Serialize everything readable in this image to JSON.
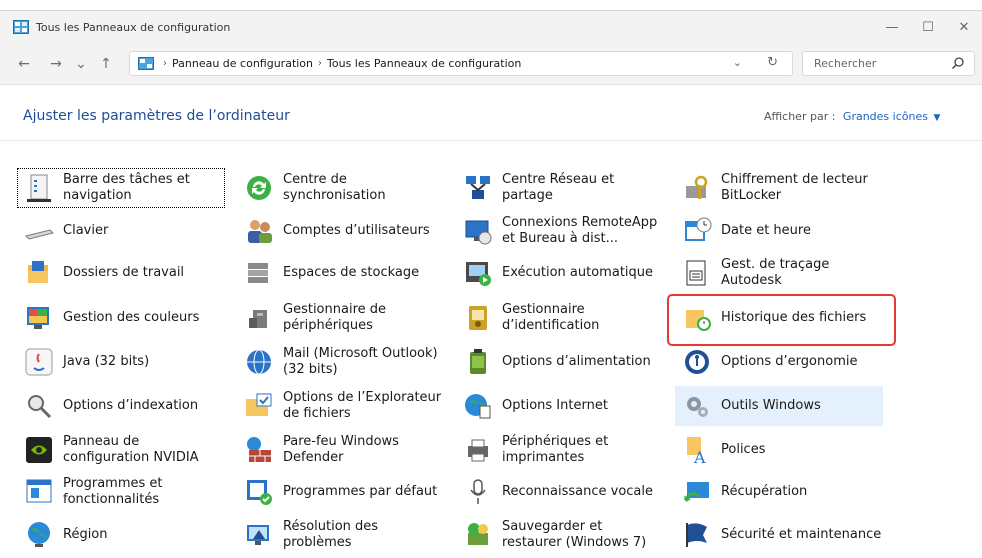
{
  "window": {
    "title": "Tous les Panneaux de configuration",
    "controls": {
      "minimize": "—",
      "maximize": "☐",
      "close": "✕"
    }
  },
  "nav": {
    "back": "←",
    "forward": "→",
    "recent": "⌄",
    "up": "↑"
  },
  "address": {
    "crumbs": [
      "Panneau de configuration",
      "Tous les Panneaux de configuration"
    ],
    "separator": "›",
    "dropdown": "⌄",
    "refresh": "↻"
  },
  "search": {
    "placeholder": "Rechercher"
  },
  "page": {
    "title": "Ajuster les paramètres de l’ordinateur",
    "view_by_label": "Afficher par :",
    "view_by_value": "Grandes icônes",
    "view_by_caret": "▼"
  },
  "items": [
    {
      "label": "Barre des tâches et navigation",
      "icon": "taskbar-icon"
    },
    {
      "label": "Centre de synchronisation",
      "icon": "sync-icon"
    },
    {
      "label": "Centre Réseau et partage",
      "icon": "network-icon"
    },
    {
      "label": "Chiffrement de lecteur BitLocker",
      "icon": "bitlocker-icon"
    },
    {
      "label": "Clavier",
      "icon": "keyboard-icon"
    },
    {
      "label": "Comptes d’utilisateurs",
      "icon": "users-icon"
    },
    {
      "label": "Connexions RemoteApp et Bureau à dist...",
      "icon": "remoteapp-icon"
    },
    {
      "label": "Date et heure",
      "icon": "clock-icon"
    },
    {
      "label": "Dossiers de travail",
      "icon": "work-folders-icon"
    },
    {
      "label": "Espaces de stockage",
      "icon": "storage-icon"
    },
    {
      "label": "Exécution automatique",
      "icon": "autoplay-icon"
    },
    {
      "label": "Gest. de traçage Autodesk",
      "icon": "autodesk-icon"
    },
    {
      "label": "Gestion des couleurs",
      "icon": "color-icon"
    },
    {
      "label": "Gestionnaire de périphériques",
      "icon": "device-manager-icon"
    },
    {
      "label": "Gestionnaire d’identification",
      "icon": "credential-icon"
    },
    {
      "label": "Historique des fichiers",
      "icon": "file-history-icon"
    },
    {
      "label": "Java (32 bits)",
      "icon": "java-icon"
    },
    {
      "label": "Mail (Microsoft Outlook) (32 bits)",
      "icon": "mail-icon"
    },
    {
      "label": "Options d’alimentation",
      "icon": "power-icon"
    },
    {
      "label": "Options d’ergonomie",
      "icon": "accessibility-icon"
    },
    {
      "label": "Options d’indexation",
      "icon": "indexing-icon"
    },
    {
      "label": "Options de l’Explorateur de fichiers",
      "icon": "explorer-options-icon"
    },
    {
      "label": "Options Internet",
      "icon": "internet-icon"
    },
    {
      "label": "Outils Windows",
      "icon": "gear-tools-icon"
    },
    {
      "label": "Panneau de configuration NVIDIA",
      "icon": "nvidia-icon"
    },
    {
      "label": "Pare-feu Windows Defender",
      "icon": "firewall-icon"
    },
    {
      "label": "Périphériques et imprimantes",
      "icon": "printer-icon"
    },
    {
      "label": "Polices",
      "icon": "fonts-icon"
    },
    {
      "label": "Programmes et fonctionnalités",
      "icon": "programs-icon"
    },
    {
      "label": "Programmes par défaut",
      "icon": "default-programs-icon"
    },
    {
      "label": "Reconnaissance vocale",
      "icon": "microphone-icon"
    },
    {
      "label": "Récupération",
      "icon": "recovery-icon"
    },
    {
      "label": "Région",
      "icon": "globe-icon"
    },
    {
      "label": "Résolution des problèmes",
      "icon": "troubleshoot-icon"
    },
    {
      "label": "Sauvegarder et restaurer (Windows 7)",
      "icon": "backup-icon"
    },
    {
      "label": "Sécurité et maintenance",
      "icon": "flag-icon"
    }
  ],
  "colors": {
    "highlight": "#e53935",
    "link": "#1e64c8",
    "title": "#1e4e9a",
    "selected_bg": "#e4f0fb"
  }
}
